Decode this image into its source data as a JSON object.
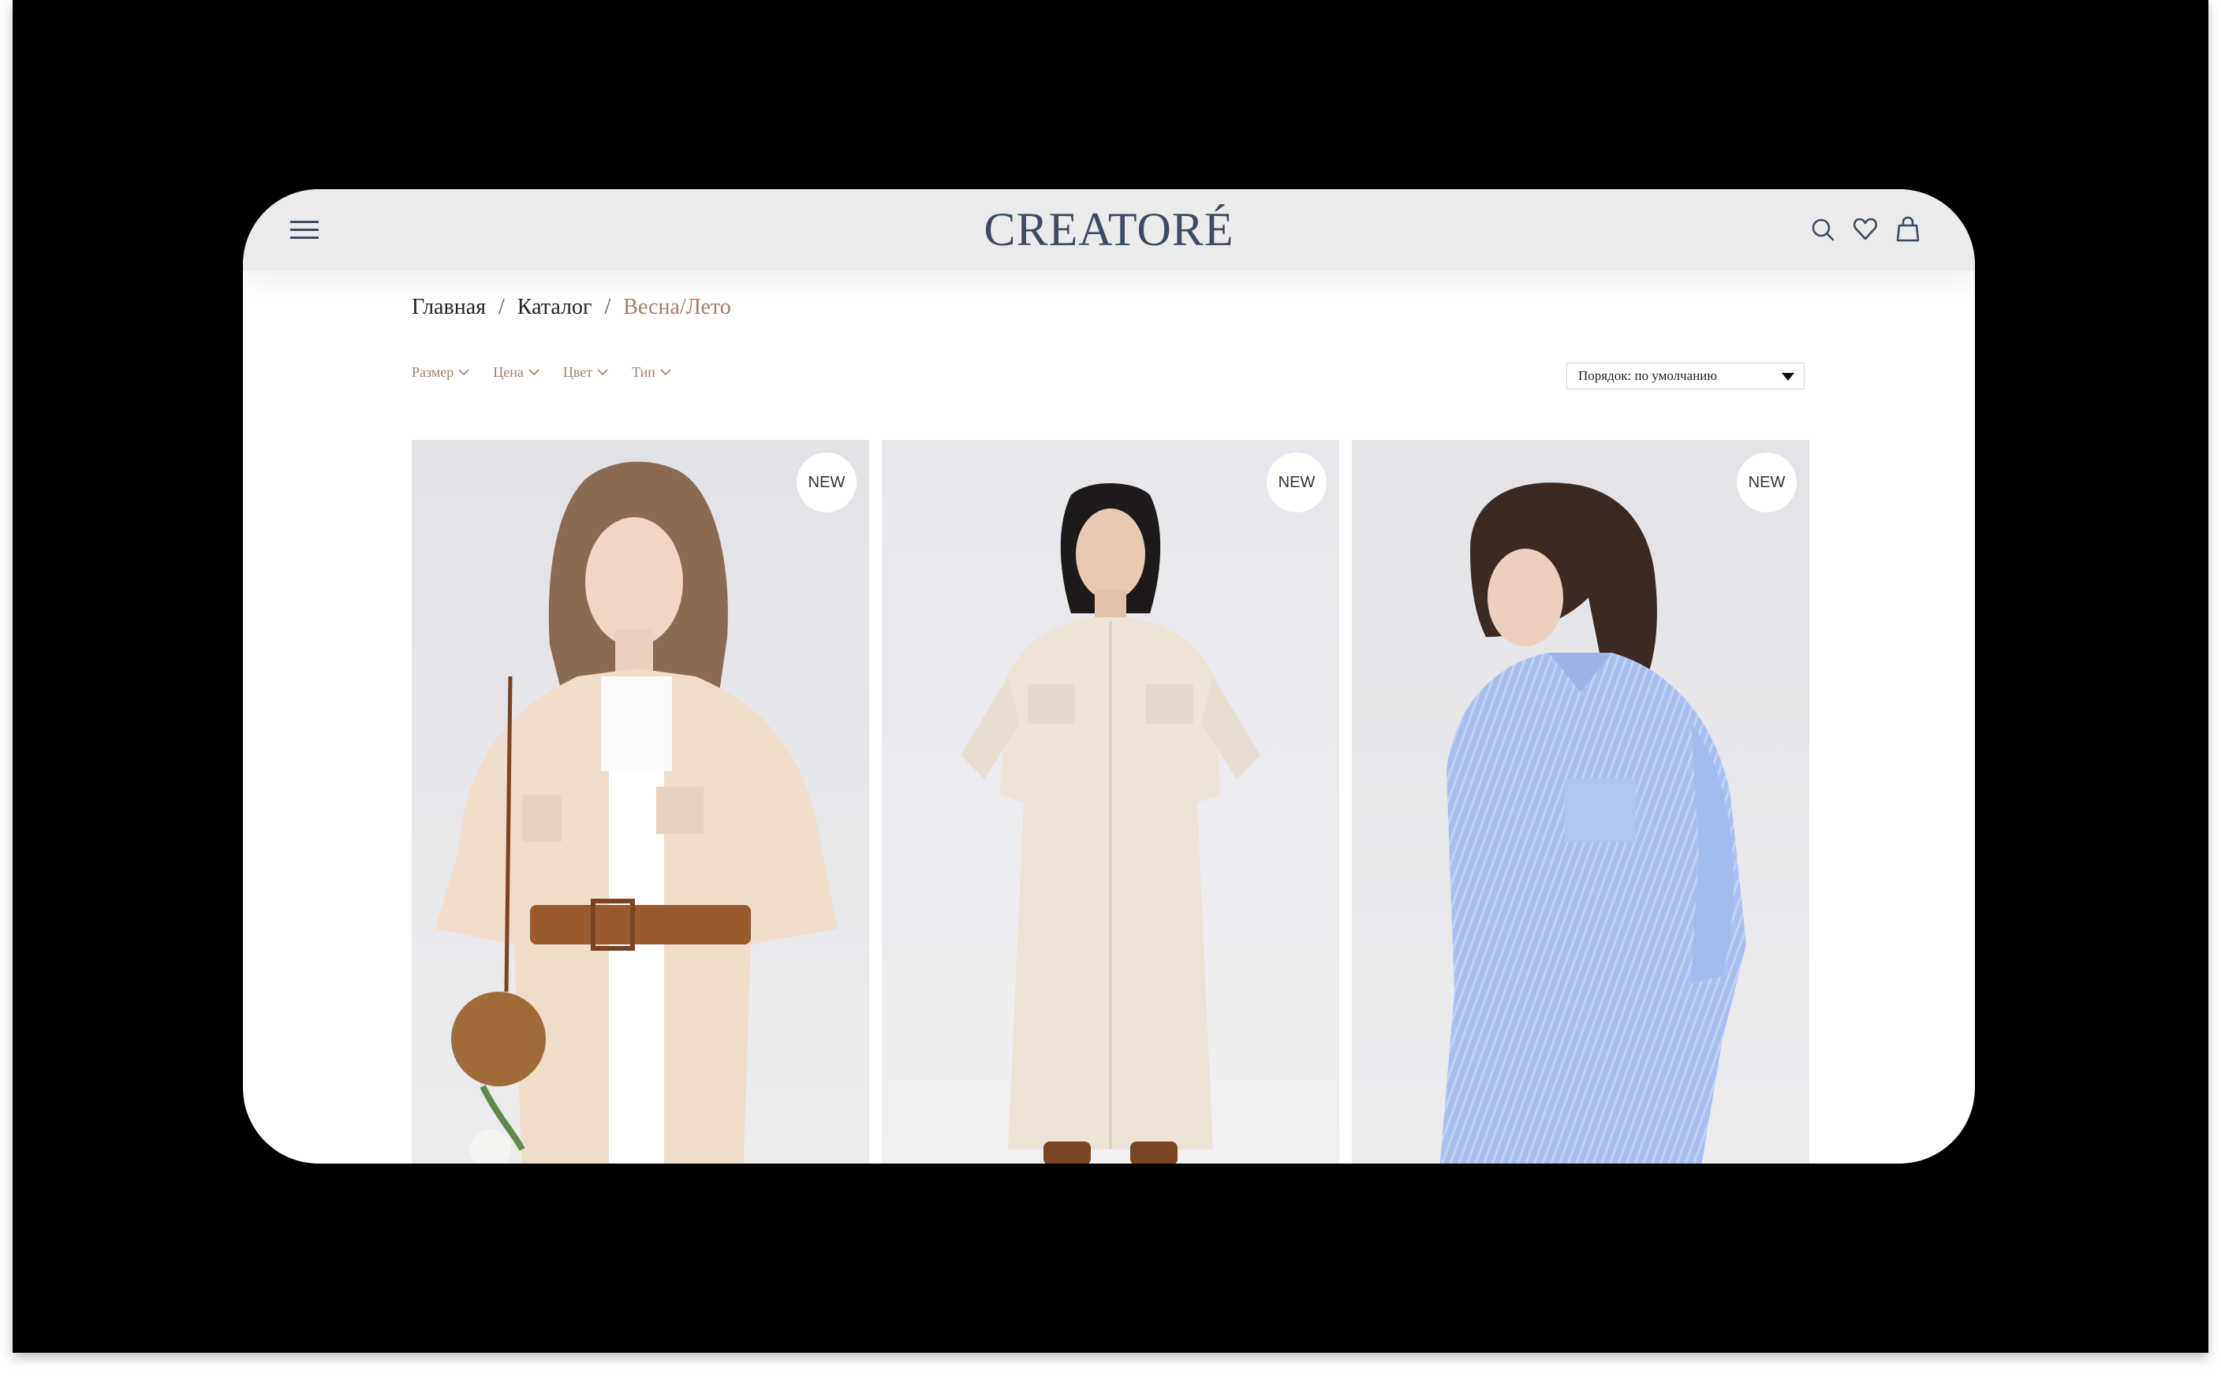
{
  "header": {
    "logo": "CREATORÉ",
    "icons": [
      "menu-icon",
      "search-icon",
      "heart-icon",
      "bag-icon"
    ]
  },
  "breadcrumb": {
    "home": "Главная",
    "catalog": "Каталог",
    "current": "Весна/Лето",
    "separator": "/"
  },
  "filters": [
    {
      "label": "Размер"
    },
    {
      "label": "Цена"
    },
    {
      "label": "Цвет"
    },
    {
      "label": "Тип"
    }
  ],
  "sort": {
    "selected": "Порядок: по умолчанию"
  },
  "products": [
    {
      "badge": "NEW",
      "image": "model-in-beige-striped-shirt-with-brown-belt"
    },
    {
      "badge": "NEW",
      "image": "model-in-long-beige-shirt-dress"
    },
    {
      "badge": "NEW",
      "image": "model-in-blue-striped-oversized-shirt"
    }
  ],
  "colors": {
    "logo": "#3c4a63",
    "accent": "#a57c67",
    "header_bg": "#ebebeb",
    "frame": "#000000"
  }
}
